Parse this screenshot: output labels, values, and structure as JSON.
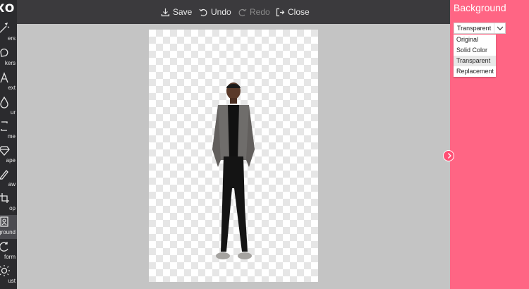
{
  "app": {
    "brand": "XO"
  },
  "toolbar": {
    "save_label": "Save",
    "undo_label": "Undo",
    "redo_label": "Redo",
    "close_label": "Close"
  },
  "sidebar": {
    "items": [
      {
        "label": "ers",
        "icon": "filters-icon",
        "active": false
      },
      {
        "label": "kers",
        "icon": "stickers-icon",
        "active": false
      },
      {
        "label": "ext",
        "icon": "text-icon",
        "active": false
      },
      {
        "label": "ur",
        "icon": "blur-icon",
        "active": false
      },
      {
        "label": "me",
        "icon": "frame-icon",
        "active": false
      },
      {
        "label": "ape",
        "icon": "shape-icon",
        "active": false
      },
      {
        "label": "aw",
        "icon": "draw-icon",
        "active": false
      },
      {
        "label": "op",
        "icon": "crop-icon",
        "active": false
      },
      {
        "label": "ground",
        "icon": "background-icon",
        "active": true
      },
      {
        "label": "form",
        "icon": "transform-icon",
        "active": false
      },
      {
        "label": "ust",
        "icon": "adjust-icon",
        "active": false
      }
    ]
  },
  "panel": {
    "title": "Background",
    "select": {
      "value": "Transparent",
      "options": [
        "Original",
        "Solid Color",
        "Transparent",
        "Replacement"
      ],
      "selected_index": 2
    }
  },
  "colors": {
    "accent": "#ff6584",
    "sidebar_bg": "#2b2b2e",
    "topbar_bg": "#3b3a3d",
    "canvas_bg": "#c4c4c4"
  }
}
